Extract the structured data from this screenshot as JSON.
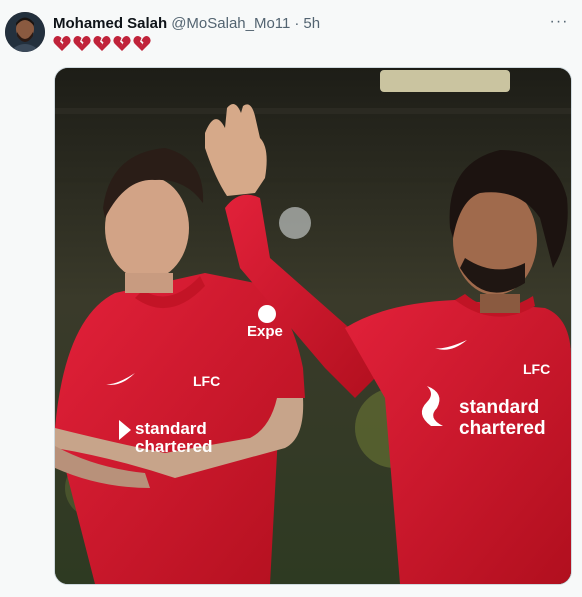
{
  "tweet": {
    "author_name": "Mohamed Salah",
    "handle": "@MoSalah_Mo11",
    "separator": "·",
    "time": "5h",
    "text_icons": [
      "broken-heart-icon",
      "broken-heart-icon",
      "broken-heart-icon",
      "broken-heart-icon",
      "broken-heart-icon"
    ],
    "more_label": "···"
  },
  "media": {
    "sponsor_text_1": "standard",
    "sponsor_text_2": "chartered",
    "sleeve_text": "Expe",
    "club_crest": "LFC"
  },
  "colors": {
    "kit_red": "#d2142a",
    "heart_red": "#c0233a",
    "text_primary": "#0f1419",
    "text_secondary": "#536471"
  }
}
